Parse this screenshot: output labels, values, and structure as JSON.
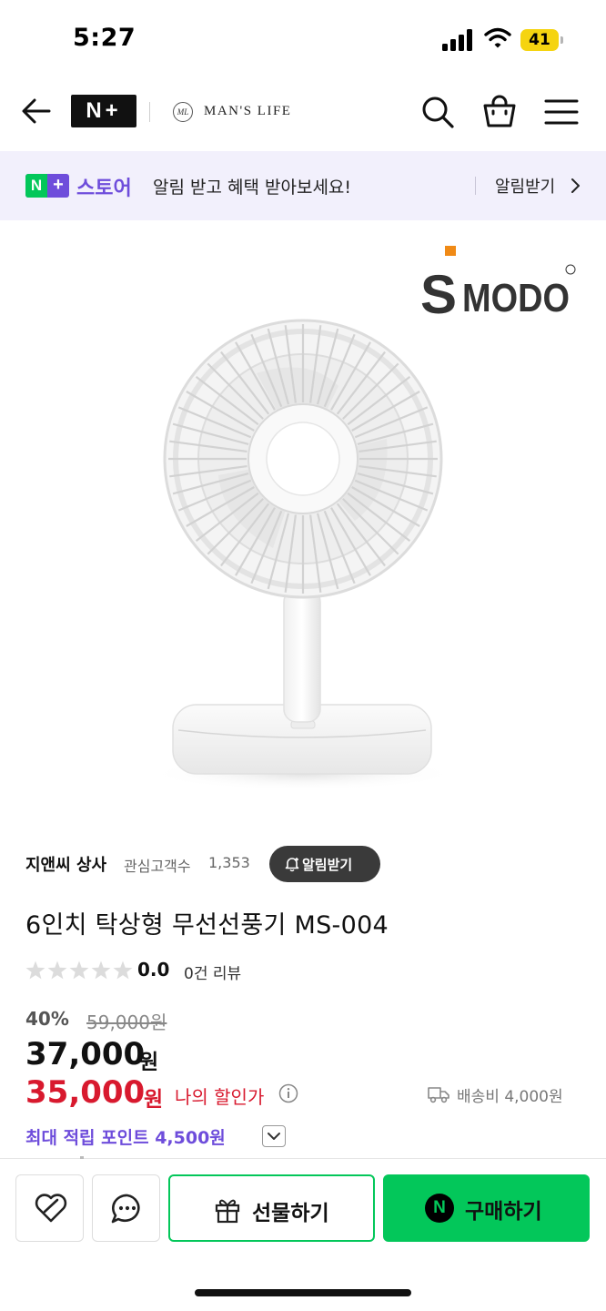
{
  "status_bar": {
    "time": "5:27",
    "battery": "41"
  },
  "header": {
    "brand_badge": "N+",
    "brand_monogram": "ML",
    "brand_name": "MAN'S LIFE"
  },
  "notice_banner": {
    "badge": "N+",
    "store_label": "스토어",
    "message": "알림 받고 혜택 받아보세요!",
    "action": "알림받기"
  },
  "product_image": {
    "logo_text": "MODO",
    "logo_initial": "S",
    "description": "white desk fan"
  },
  "seller": {
    "name": "지앤씨 상사",
    "followers_label": "관심고객수",
    "followers_count": "1,353",
    "follow_label": "알림받기"
  },
  "product": {
    "title": "6인치 탁상형 무선선풍기 MS-004",
    "rating": {
      "score": "0.0",
      "stars": 0,
      "max_stars": 5,
      "review_count": "0건 리뷰"
    },
    "price": {
      "discount_rate": "40%",
      "original": "59,000원",
      "sale": "37,000",
      "sale_unit": "원",
      "my_price": "35,000",
      "my_unit": "원",
      "my_label": "나의 할인가"
    },
    "shipping": "배송비 4,000원",
    "points": "최대 적립 포인트 4,500원"
  },
  "actions": {
    "gift_label": "선물하기",
    "buy_badge": "N",
    "buy_label": "구매하기"
  },
  "colors": {
    "naver_green": "#03c75a",
    "store_purple": "#6e4ddb",
    "price_red": "#d8192e"
  },
  "icons": [
    "back-icon",
    "search-icon",
    "cart-icon",
    "menu-icon",
    "chevron-right-icon",
    "bell-icon",
    "star-icon",
    "info-icon",
    "truck-icon",
    "chevron-down-icon",
    "heart-icon",
    "chat-icon",
    "gift-icon"
  ]
}
